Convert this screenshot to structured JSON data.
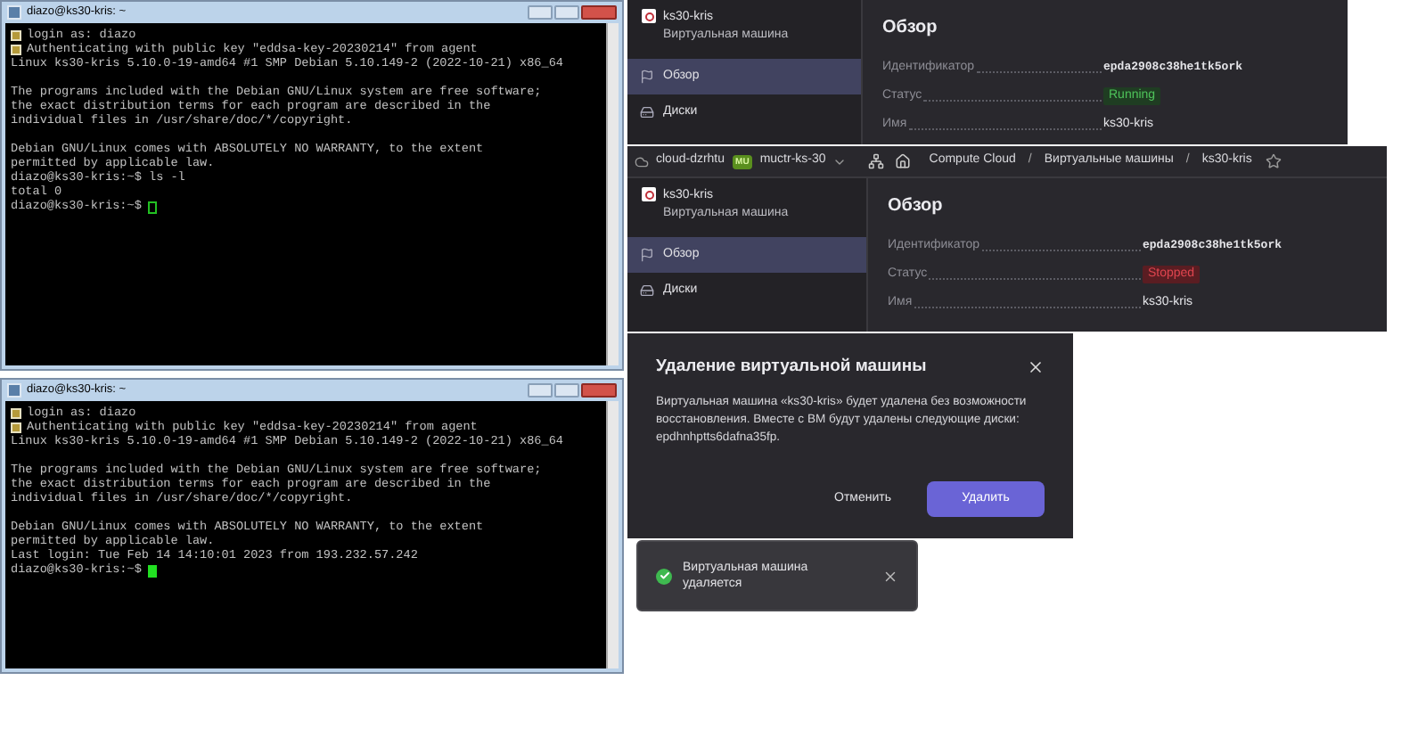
{
  "terminals": [
    {
      "title": "diazo@ks30-kris: ~",
      "focused": false,
      "blocks": [
        [
          "login as: diazo",
          "Authenticating with public key \"eddsa-key-20230214\" from agent",
          "Linux ks30-kris 5.10.0-19-amd64 #1 SMP Debian 5.10.149-2 (2022-10-21) x86_64"
        ],
        [
          "The programs included with the Debian GNU/Linux system are free software;",
          "the exact distribution terms for each program are described in the",
          "individual files in /usr/share/doc/*/copyright."
        ],
        [
          "Debian GNU/Linux comes with ABSOLUTELY NO WARRANTY, to the extent",
          "permitted by applicable law.",
          "diazo@ks30-kris:~$ ls -l",
          "total 0",
          "diazo@ks30-kris:~$"
        ]
      ]
    },
    {
      "title": "diazo@ks30-kris: ~",
      "focused": true,
      "blocks": [
        [
          "login as: diazo",
          "Authenticating with public key \"eddsa-key-20230214\" from agent",
          "Linux ks30-kris 5.10.0-19-amd64 #1 SMP Debian 5.10.149-2 (2022-10-21) x86_64"
        ],
        [
          "The programs included with the Debian GNU/Linux system are free software;",
          "the exact distribution terms for each program are described in the",
          "individual files in /usr/share/doc/*/copyright."
        ],
        [
          "Debian GNU/Linux comes with ABSOLUTELY NO WARRANTY, to the extent",
          "permitted by applicable law.",
          "Last login: Tue Feb 14 14:10:01 2023 from 193.232.57.242",
          "diazo@ks30-kris:~$"
        ]
      ]
    }
  ],
  "console_panels": [
    {
      "vm_name": "ks30-kris",
      "vm_type": "Виртуальная машина",
      "nav": [
        {
          "label": "Обзор",
          "kind": "overview",
          "selected": true
        },
        {
          "label": "Диски",
          "kind": "disks",
          "selected": false
        }
      ],
      "heading": "Обзор",
      "fields": [
        {
          "label": "Идентификатор",
          "value": "epda2908c38he1tk5ork",
          "kind": "id"
        },
        {
          "label": "Статус",
          "value": "Running",
          "kind": "ok"
        },
        {
          "label": "Имя",
          "value": "ks30-kris",
          "kind": "text"
        }
      ]
    },
    {
      "breadcrumb": {
        "cloud": "cloud-dzrhtu",
        "folder_badge": "MU",
        "folder": "muctr-ks-30",
        "path": [
          "Compute Cloud",
          "Виртуальные машины",
          "ks30-kris"
        ],
        "separator": "/"
      },
      "vm_name": "ks30-kris",
      "vm_type": "Виртуальная машина",
      "nav": [
        {
          "label": "Обзор",
          "kind": "overview",
          "selected": true
        },
        {
          "label": "Диски",
          "kind": "disks",
          "selected": false
        }
      ],
      "heading": "Обзор",
      "fields": [
        {
          "label": "Идентификатор",
          "value": "epda2908c38he1tk5ork",
          "kind": "id"
        },
        {
          "label": "Статус",
          "value": "Stopped",
          "kind": "error"
        },
        {
          "label": "Имя",
          "value": "ks30-kris",
          "kind": "text"
        }
      ]
    }
  ],
  "dialog": {
    "title": "Удаление виртуальной машины",
    "body": "Виртуальная машина «ks30-kris» будет удалена без возможности восстановления. Вместе с ВМ будут удалены следующие диски: epdhnhptts6dafna35fp.",
    "buttons": [
      {
        "label": "Отменить",
        "kind": "secondary"
      },
      {
        "label": "Удалить",
        "kind": "primary"
      }
    ]
  },
  "toast": {
    "text": "Виртуальная машина удаляется"
  }
}
